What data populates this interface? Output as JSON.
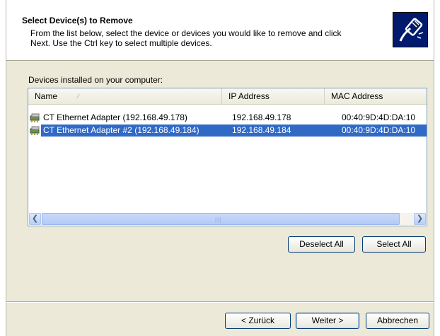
{
  "header": {
    "title": "Select Device(s) to Remove",
    "subtitle": "From the list below, select the device or devices you would like to remove and click Next. Use the Ctrl key to select multiple devices.",
    "logo_icon": "network-cable-icon"
  },
  "devices": {
    "caption": "Devices installed on your computer:",
    "columns": [
      "Name",
      "IP Address",
      "MAC Address"
    ],
    "rows": [
      {
        "name": "CT Ethernet Adapter (192.168.49.178)",
        "ip": "192.168.49.178",
        "mac": "00:40:9D:4D:DA:10",
        "selected": false
      },
      {
        "name": "CT Ethernet Adapter #2 (192.168.49.184)",
        "ip": "192.168.49.184",
        "mac": "00:40:9D:4D:DA:10",
        "selected": true
      }
    ],
    "row_icon": "network-adapter-icon"
  },
  "buttons": {
    "deselect_all": "Deselect All",
    "select_all": "Select All",
    "back": "< Zurück",
    "next": "Weiter >",
    "cancel": "Abbrechen"
  },
  "colors": {
    "selection": "#316ac5",
    "logo_background": "#001b6e",
    "dialog_background": "#ece9d8"
  }
}
